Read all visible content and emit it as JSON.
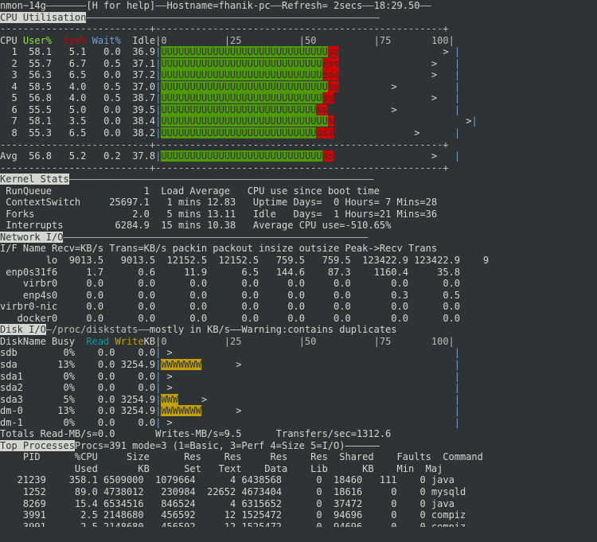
{
  "titlebar": {
    "app": "nmon−14g",
    "help": "[H for help]",
    "hostname": "Hostname=fhanik-pc",
    "refresh": "Refresh= 2secs",
    "time": "18:29.50",
    "dash": "————",
    "dash_short": "——",
    "dash_long": "———————"
  },
  "cpu": {
    "section_title": "CPU Utilisation",
    "header": {
      "cpu": "CPU",
      "user": " User%",
      "sys": "  Sys%",
      "wait": " Wait%",
      "idle": "  Idle",
      "scale": "|0          |25          |50          |75       100|"
    },
    "ruler": "--------------------------+--------------------------------------------------+",
    "rows": [
      {
        "id": "1",
        "user": "58.1",
        "sys": "5.1",
        "wait": "0.0",
        "idle": "36.9",
        "u_count": 29,
        "s_count": 2,
        "marker_col": 49
      },
      {
        "id": "2",
        "user": "55.7",
        "sys": "6.7",
        "wait": "0.5",
        "idle": "37.1",
        "u_count": 28,
        "s_count": 3,
        "marker_col": 47
      },
      {
        "id": "3",
        "user": "56.3",
        "sys": "6.5",
        "wait": "0.0",
        "idle": "37.2",
        "u_count": 28,
        "s_count": 3,
        "marker_col": 47
      },
      {
        "id": "4",
        "user": "58.5",
        "sys": "4.0",
        "wait": "0.5",
        "idle": "37.0",
        "u_count": 29,
        "s_count": 2,
        "marker_col": 40
      },
      {
        "id": "5",
        "user": "56.8",
        "sys": "4.0",
        "wait": "0.5",
        "idle": "38.7",
        "u_count": 28,
        "s_count": 2,
        "marker_col": 47
      },
      {
        "id": "6",
        "user": "55.5",
        "sys": "5.0",
        "wait": "0.0",
        "idle": "39.5",
        "u_count": 27,
        "s_count": 2,
        "marker_col": 40
      },
      {
        "id": "7",
        "user": "58.1",
        "sys": "3.5",
        "wait": "0.0",
        "idle": "38.4",
        "u_count": 29,
        "s_count": 1,
        "marker_col": 53
      },
      {
        "id": "8",
        "user": "55.3",
        "sys": "6.5",
        "wait": "0.0",
        "idle": "38.2",
        "u_count": 27,
        "s_count": 3,
        "marker_col": 44
      }
    ],
    "avg": {
      "id": "Avg",
      "user": "56.8",
      "sys": "5.2",
      "wait": "0.2",
      "idle": "37.8",
      "u_count": 28,
      "s_count": 2,
      "marker_col": 47
    }
  },
  "kernel": {
    "section_title": "Kernel Stats",
    "rows": [
      {
        "label": "RunQueue",
        "value": "1",
        "load_label": "Load Average",
        "right": "CPU use since boot time"
      },
      {
        "label": "ContextSwitch",
        "value": "25697.1",
        "load_label": " 1 mins 12.83",
        "right": " Uptime Days=  0 Hours= 7 Mins=28"
      },
      {
        "label": "Forks",
        "value": "2.0",
        "load_label": " 5 mins 13.11",
        "right": " Idle   Days=  1 Hours=21 Mins=36"
      },
      {
        "label": "Interrupts",
        "value": "6284.9",
        "load_label": "15 mins 10.38",
        "right": " Average CPU use=-510.65%"
      }
    ]
  },
  "network": {
    "section_title": "Network I/O",
    "header": "I/F Name Recv=KB/s Trans=KB/s packin packout insize outsize Peak->Recv Trans",
    "rows": [
      {
        "name": "      lo",
        "recv": " 9013.5",
        "trans": "  9013.5",
        "packin": "  12152.5",
        "packout": " 12152.5",
        "insize": "  759.5",
        "outsize": "  759.5",
        "peak_recv": " 123422.9",
        "peak_trans": " 123422.9",
        "extra": "    9"
      },
      {
        "name": "enp0s31f6",
        "recv": "   1.7",
        "trans": "      0.6",
        "packin": "     11.9",
        "packout": "     6.5",
        "insize": "  144.6",
        "outsize": "   87.3",
        "peak_recv": "  1160.4",
        "peak_trans": "    35.8",
        "extra": ""
      },
      {
        "name": "   virbr0",
        "recv": "   0.0",
        "trans": "      0.0",
        "packin": "      0.0",
        "packout": "     0.0",
        "insize": "    0.0",
        "outsize": "    0.0",
        "peak_recv": "     0.0",
        "peak_trans": "     0.0",
        "extra": ""
      },
      {
        "name": "   enp4s0",
        "recv": "   0.0",
        "trans": "      0.0",
        "packin": "      0.0",
        "packout": "     0.0",
        "insize": "    0.0",
        "outsize": "    0.0",
        "peak_recv": "     0.3",
        "peak_trans": "     0.5",
        "extra": ""
      },
      {
        "name": "virbr0-nic",
        "recv": "  0.0",
        "trans": "      0.0",
        "packin": "      0.0",
        "packout": "     0.0",
        "insize": "    0.0",
        "outsize": "    0.0",
        "peak_recv": "     0.0",
        "peak_trans": "     0.0",
        "extra": ""
      },
      {
        "name": "  docker0",
        "recv": "   0.0",
        "trans": "      0.0",
        "packin": "      0.0",
        "packout": "     0.0",
        "insize": "    0.0",
        "outsize": "    0.0",
        "peak_recv": "     0.0",
        "peak_trans": "     0.0",
        "extra": ""
      }
    ]
  },
  "disk": {
    "section_title": "Disk I/O",
    "title_suffix_a": "—/proc/diskstats——",
    "title_suffix_b": "mostly in KB/s——",
    "title_suffix_c": "Warning:contains duplicates",
    "header": {
      "name": "DiskName",
      "busy": " Busy",
      "read": "  Read",
      "write": " Write",
      "kb": "KB",
      "scale": "|0          |25          |50          |75       100|"
    },
    "rows": [
      {
        "name": "sdb  ",
        "busy": "  0%",
        "read": "  0.0",
        "write": "    0.0",
        "w_count": 0,
        "marker_col": 1
      },
      {
        "name": "sda  ",
        "busy": " 13%",
        "read": "  0.0",
        "write": " 3254.9",
        "w_count": 7,
        "marker_col": 13
      },
      {
        "name": "sda1 ",
        "busy": "  0%",
        "read": "  0.0",
        "write": "    0.0",
        "w_count": 0,
        "marker_col": 1
      },
      {
        "name": "sda2 ",
        "busy": "  0%",
        "read": "  0.0",
        "write": "    0.0",
        "w_count": 0,
        "marker_col": 1
      },
      {
        "name": "sda3 ",
        "busy": "  5%",
        "read": "  0.0",
        "write": " 3254.9",
        "w_count": 3,
        "marker_col": 7
      },
      {
        "name": "dm-0 ",
        "busy": " 13%",
        "read": "  0.0",
        "write": " 3254.9",
        "w_count": 7,
        "marker_col": 13
      },
      {
        "name": "dm-1 ",
        "busy": "  0%",
        "read": "  0.0",
        "write": "    0.0",
        "w_count": 0,
        "marker_col": 1
      }
    ],
    "totals": "Totals Read-MB/s=0.0       Writes-MB/s=9.5      Transfers/sec=1312.6"
  },
  "top": {
    "section_title": "Top Processes",
    "title_suffix": "Procs=391 mode=3 (1=Basic, 3=Perf 4=Size 5=I/O)——————",
    "header_line1": "    PID      %CPU     Size      Res    Res     Res    Res  Shared    Faults  Command",
    "header_line2": "             Used       KB      Set   Text    Data    Lib      KB    Min  Maj",
    "rows": [
      {
        "pid": "   21239",
        "cpu": "  358.1",
        "size": " 6509000",
        "res_set": " 1079664",
        "res_text": "     4",
        "res_data": "6438568",
        "res_lib": "      0",
        "shared": " 18460",
        "min": "  111",
        "maj": "    0",
        "command": " java"
      },
      {
        "pid": "    1252",
        "cpu": "   89.0",
        "size": " 4738012",
        "res_set": "  230984",
        "res_text": " 22652",
        "res_data": "4673404",
        "res_lib": "      0",
        "shared": " 18616",
        "min": "    0",
        "maj": "    0",
        "command": " mysqld"
      },
      {
        "pid": "    8269",
        "cpu": "   15.4",
        "size": " 6534516",
        "res_set": "  846524",
        "res_text": "     4",
        "res_data": "6315652",
        "res_lib": "      0",
        "shared": " 37472",
        "min": "    0",
        "maj": "    0",
        "command": " java"
      },
      {
        "pid": "    3991",
        "cpu": "    2.5",
        "size": " 2148680",
        "res_set": "  456592",
        "res_text": "    12",
        "res_data": "1525472",
        "res_lib": "      0",
        "shared": " 94696",
        "min": "    0",
        "maj": "    0",
        "command": " compiz"
      }
    ]
  },
  "colors": {
    "background": "#2e3436",
    "foreground": "#d3d7cf",
    "user_green": "#4e9a06",
    "sys_red": "#cc0000",
    "wait_blue": "#729fcf",
    "read_cyan": "#06989a",
    "write_yellow": "#c4a000",
    "header_bg": "#d3d7cf"
  }
}
